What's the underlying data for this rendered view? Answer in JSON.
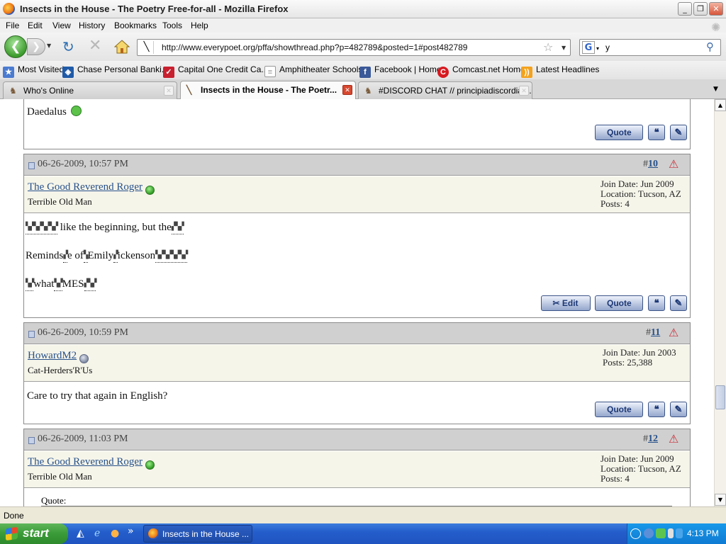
{
  "window": {
    "title": "Insects in the House - The Poetry Free-for-all - Mozilla Firefox"
  },
  "menu": [
    "File",
    "Edit",
    "View",
    "History",
    "Bookmarks",
    "Tools",
    "Help"
  ],
  "nav": {
    "url": "http://www.everypoet.org/pffa/showthread.php?p=482789&posted=1#post482789",
    "search_value": "y"
  },
  "bookmarks": [
    {
      "label": "Most Visited",
      "icon": "star-folder-icon",
      "color": "#4a7bd0"
    },
    {
      "label": "Chase Personal Banki...",
      "icon": "chase-logo-icon",
      "color": "#1f5aa8"
    },
    {
      "label": "Capital One Credit Ca...",
      "icon": "capital-one-icon",
      "color": "#c8202f"
    },
    {
      "label": "Amphitheater Schools",
      "icon": "page-icon",
      "color": "#ffffff"
    },
    {
      "label": "Facebook | Home",
      "icon": "facebook-icon",
      "color": "#3b5998"
    },
    {
      "label": "Comcast.net Home",
      "icon": "comcast-icon",
      "color": "#d71a20"
    },
    {
      "label": "Latest Headlines",
      "icon": "rss-icon",
      "color": "#f4a21d"
    }
  ],
  "tabs": [
    {
      "label": "Who's Online",
      "active": false
    },
    {
      "label": "Insects in the House - The Poetr...",
      "active": true
    },
    {
      "label": "#DISCORD CHAT // principiadiscordia.c...",
      "active": false
    }
  ],
  "top_fragment": {
    "signature": "Daedalus"
  },
  "posts": [
    {
      "date": "06-26-2009, 10:57 PM",
      "number_prefix": "#",
      "number": "10",
      "username": "The Good Reverend Roger",
      "online": true,
      "user_title": "Terrible Old Man",
      "info": [
        "Join Date: Jun 2009",
        "Location: Tucson, AZ",
        "Posts: 4"
      ],
      "body": [
        {
          "pre": "",
          "garb1": "▚▞▚▞▚▞▚▞",
          "text": " like the beginning, but the",
          "garb2": "▞▚▞"
        },
        {
          "pre": "Reminds",
          "garb1": "▞",
          "text": "e of",
          "garb2": "▚",
          "text2": "Emily",
          "garb3": "▞",
          "text3": "ickenson",
          "garb4": "▚▞▚▞▚▞▚▞"
        },
        {
          "pre": "",
          "garb1": "▚▞",
          "text": "what",
          "garb2": "▚▞",
          "text2": "MES",
          "garb3": "▞▚▞"
        }
      ],
      "buttons": {
        "edit": "Edit",
        "quote": "Quote"
      }
    },
    {
      "date": "06-26-2009, 10:59 PM",
      "number_prefix": "#",
      "number": "11",
      "username": "HowardM2",
      "online": false,
      "user_title": "Cat-Herders'R'Us",
      "info": [
        "Join Date: Jun 2003",
        "Posts: 25,388"
      ],
      "body_text": "Care to try that again in English?",
      "buttons": {
        "quote": "Quote"
      }
    },
    {
      "date": "06-26-2009, 11:03 PM",
      "number_prefix": "#",
      "number": "12",
      "username": "The Good Reverend Roger",
      "online": true,
      "user_title": "Terrible Old Man",
      "info": [
        "Join Date: Jun 2009",
        "Location: Tucson, AZ",
        "Posts: 4"
      ],
      "quote_label": "Quote:"
    }
  ],
  "buttons_common": {
    "quote": "Quote"
  },
  "status": {
    "text": "Done"
  },
  "taskbar": {
    "start": "start",
    "item": "Insects in the House ...",
    "clock": "4:13 PM"
  }
}
